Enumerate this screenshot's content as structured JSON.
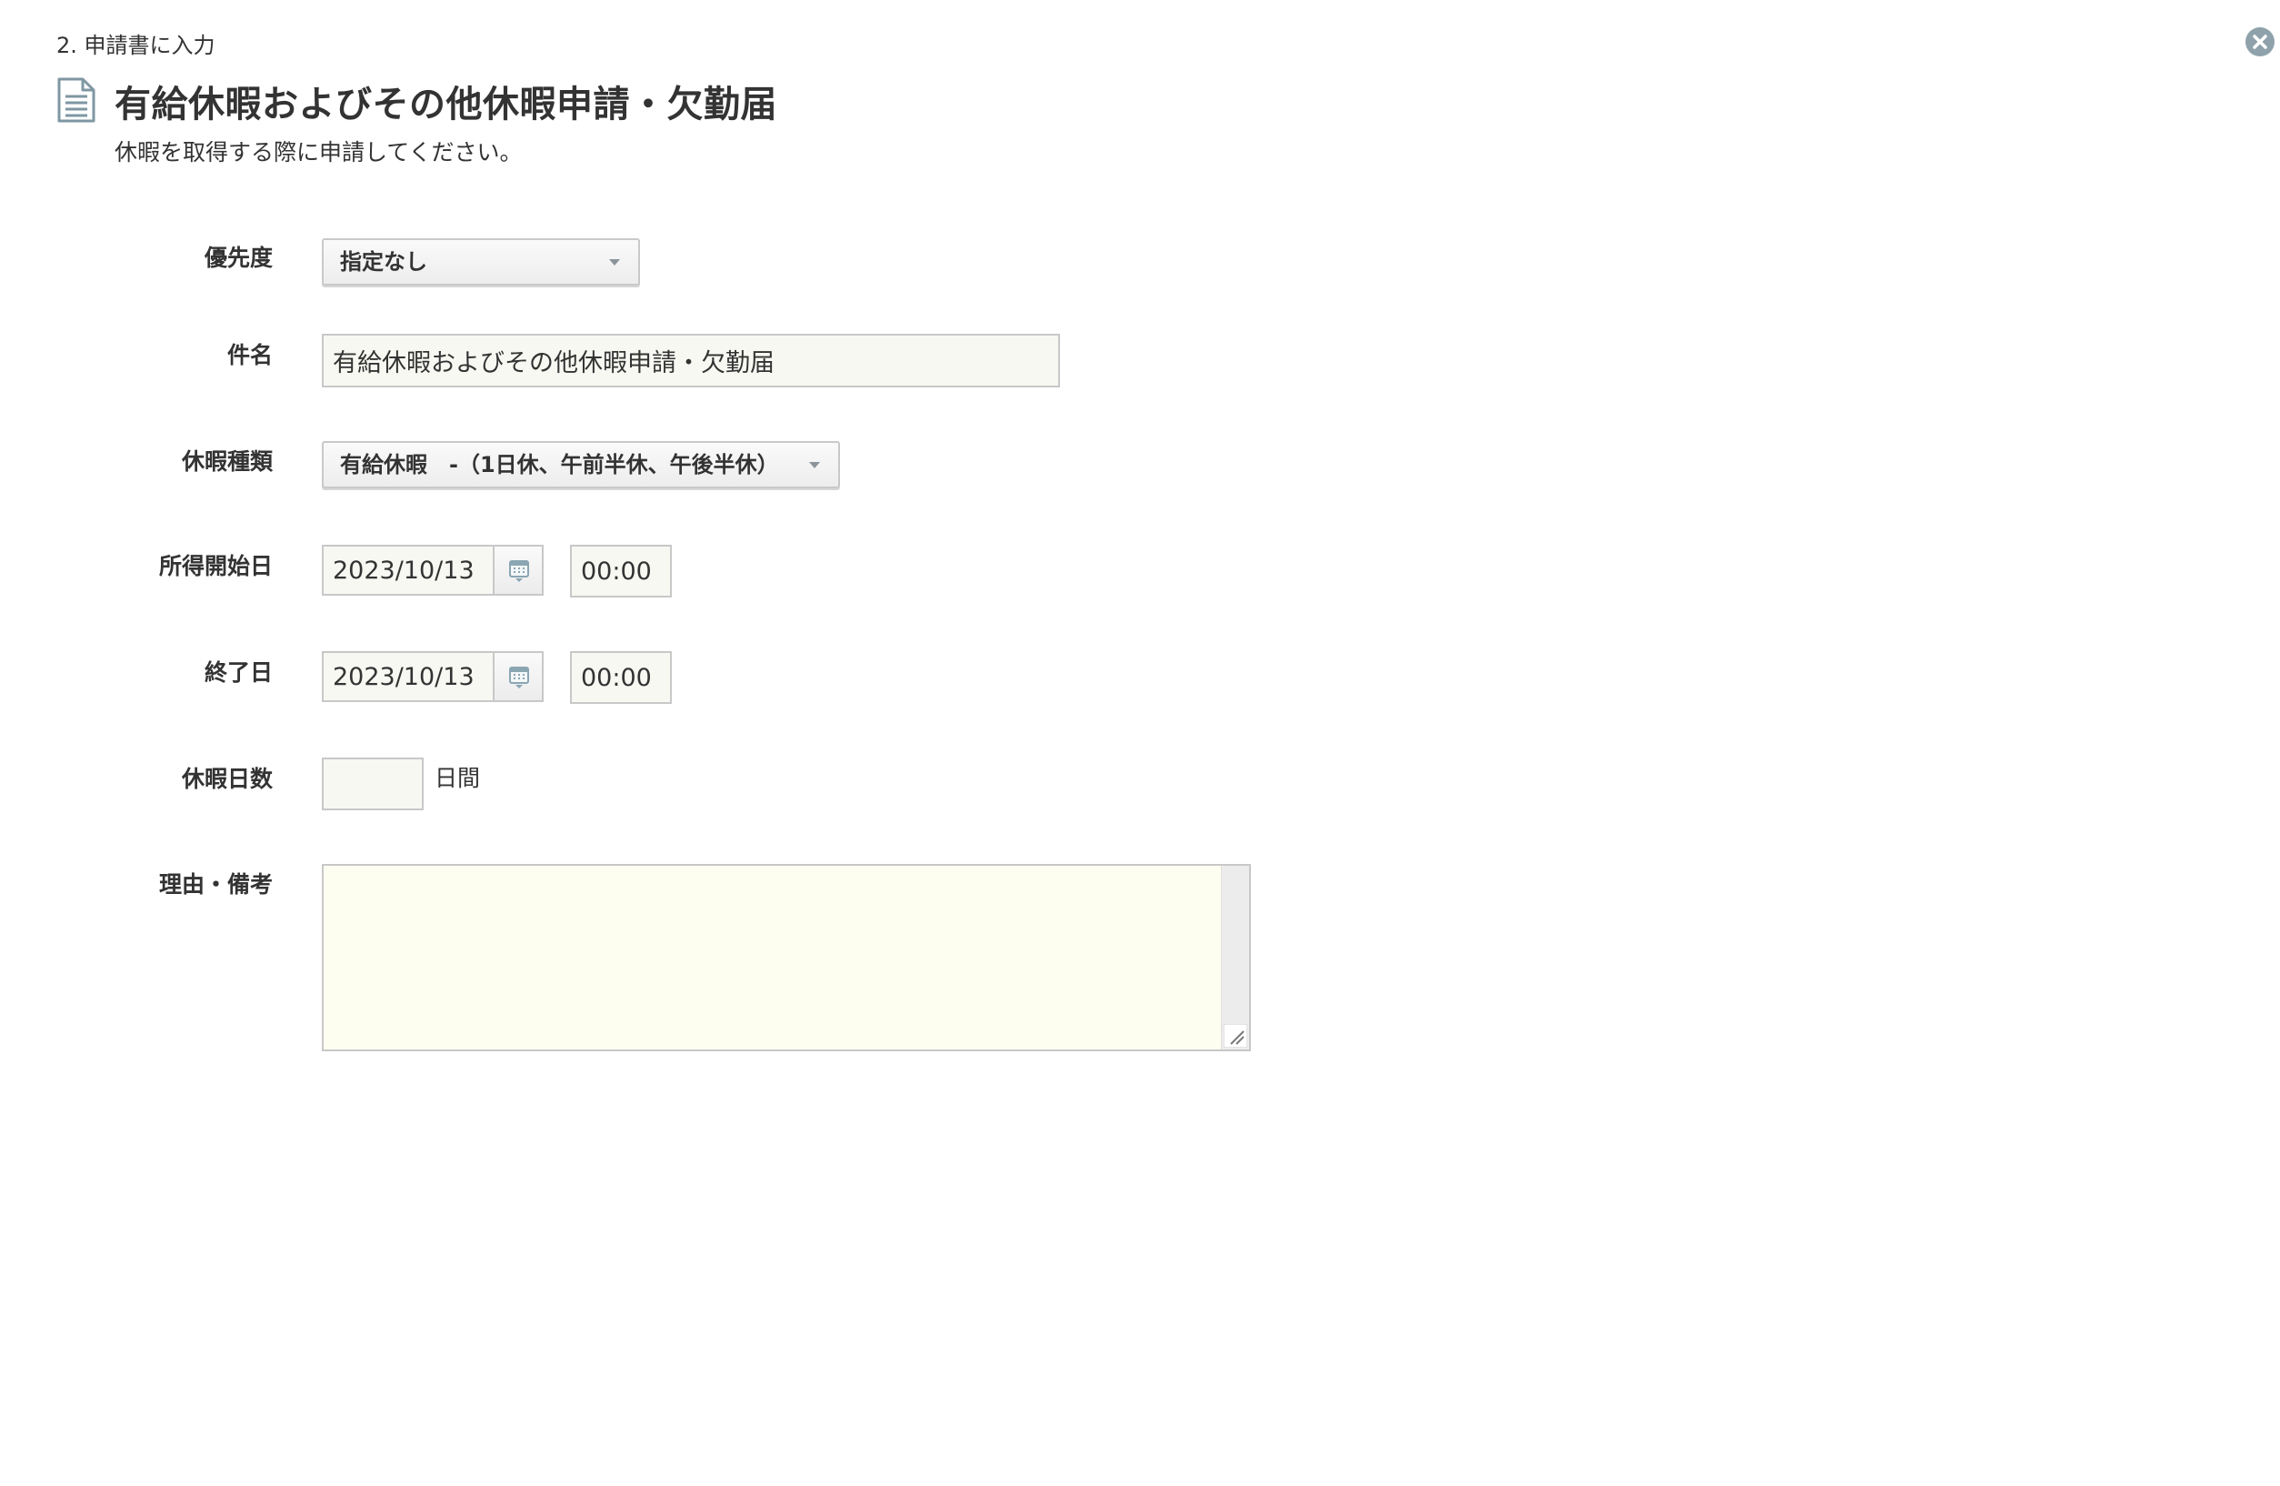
{
  "step": {
    "label": "2. 申請書に入力"
  },
  "header": {
    "title": "有給休暇およびその他休暇申請・欠勤届",
    "description": "休暇を取得する際に申請してください。"
  },
  "form": {
    "priority": {
      "label": "優先度",
      "value": "指定なし"
    },
    "subject": {
      "label": "件名",
      "value": "有給休暇およびその他休暇申請・欠勤届"
    },
    "leave_type": {
      "label": "休暇種類",
      "value": "有給休暇　-（1日休、午前半休、午後半休）"
    },
    "start_date": {
      "label": "所得開始日",
      "date": "2023/10/13",
      "time": "00:00"
    },
    "end_date": {
      "label": "終了日",
      "date": "2023/10/13",
      "time": "00:00"
    },
    "leave_days": {
      "label": "休暇日数",
      "value": "",
      "unit": "日間"
    },
    "reason": {
      "label": "理由・備考",
      "value": ""
    }
  },
  "icons": {
    "close": "close-icon",
    "document": "document-icon",
    "calendar": "calendar-icon",
    "dropdown": "chevron-down-icon"
  },
  "colors": {
    "textarea_bg": "#fdfdf0",
    "input_bg": "#f8f8f3",
    "close_bg": "#8fa2ac",
    "icon_color": "#7f97a3"
  }
}
